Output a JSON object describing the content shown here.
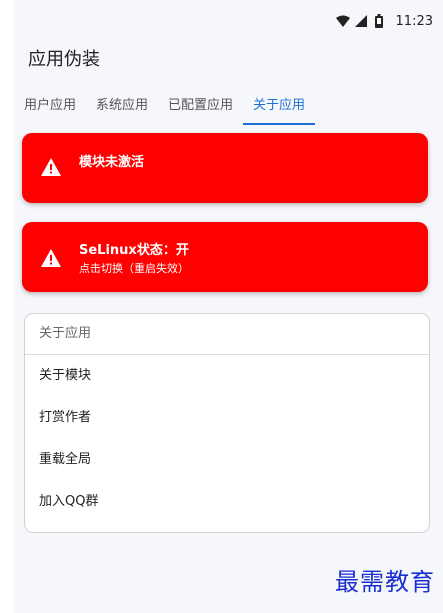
{
  "status_bar": {
    "time": "11:23",
    "icons": [
      "wifi-icon",
      "signal-icon",
      "battery-icon"
    ]
  },
  "app": {
    "title": "应用伪装"
  },
  "tabs": [
    {
      "label": "用户应用",
      "active": false
    },
    {
      "label": "系统应用",
      "active": false
    },
    {
      "label": "已配置应用",
      "active": false
    },
    {
      "label": "关于应用",
      "active": true
    }
  ],
  "alerts": [
    {
      "title": "模块未激活",
      "subtitle": ""
    },
    {
      "title": "SeLinux状态：开",
      "subtitle": "点击切换（重启失效）"
    }
  ],
  "about_card": {
    "header": "关于应用",
    "items": [
      "关于模块",
      "打赏作者",
      "重载全局",
      "加入QQ群"
    ]
  },
  "watermark": "最需教育",
  "colors": {
    "accent": "#1e6fd6",
    "alert": "#ff0000",
    "watermark": "#1a2fd0"
  }
}
